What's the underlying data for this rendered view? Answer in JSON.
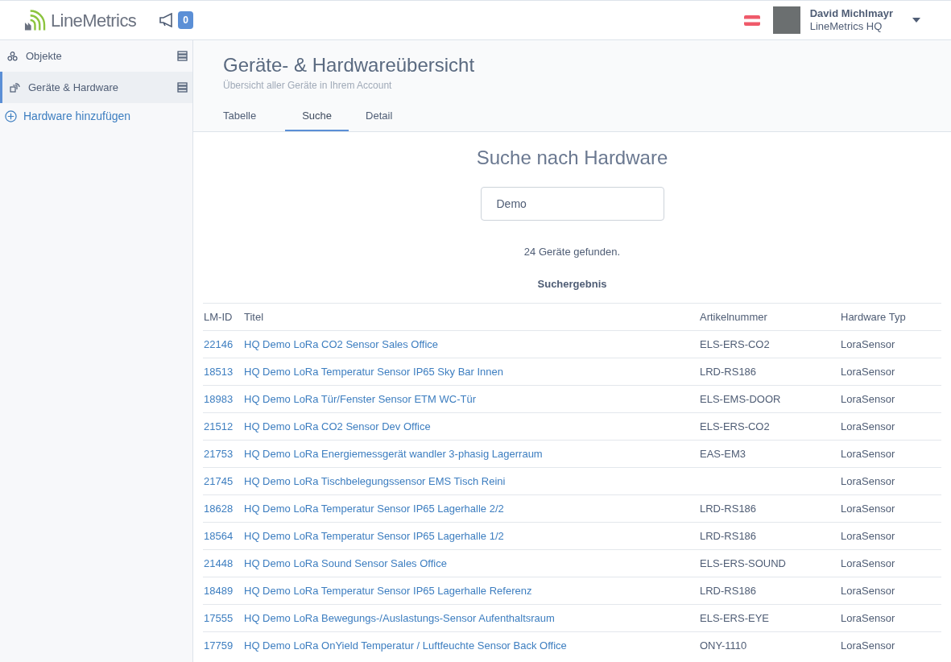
{
  "header": {
    "logo": "LineMetrics",
    "notifications": "0",
    "user": {
      "name": "David Michlmayr",
      "org": "LineMetrics HQ"
    }
  },
  "sidebar": {
    "items": [
      {
        "label": "Objekte",
        "selected": false
      },
      {
        "label": "Geräte & Hardware",
        "selected": true
      }
    ],
    "add_link": "Hardware hinzufügen"
  },
  "page": {
    "title": "Geräte- & Hardwareübersicht",
    "subtitle": "Übersicht aller Geräte in Ihrem Account"
  },
  "tabs": [
    {
      "label": "Tabelle",
      "selected": false
    },
    {
      "label": "Suche",
      "selected": true
    },
    {
      "label": "Detail",
      "selected": false
    }
  ],
  "search": {
    "heading": "Suche nach Hardware",
    "value": "Demo",
    "result_count": "24 Geräte gefunden.",
    "result_heading": "Suchergebnis"
  },
  "table": {
    "columns": [
      "LM-ID",
      "Titel",
      "Artikelnummer",
      "Hardware Typ"
    ],
    "rows": [
      [
        "22146",
        "HQ Demo LoRa CO2 Sensor Sales Office",
        "ELS-ERS-CO2",
        "LoraSensor"
      ],
      [
        "18513",
        "HQ Demo LoRa Temperatur Sensor IP65 Sky Bar Innen",
        "LRD-RS186",
        "LoraSensor"
      ],
      [
        "18983",
        "HQ Demo LoRa Tür/Fenster Sensor ETM WC-Tür",
        "ELS-EMS-DOOR",
        "LoraSensor"
      ],
      [
        "21512",
        "HQ Demo LoRa CO2 Sensor Dev Office",
        "ELS-ERS-CO2",
        "LoraSensor"
      ],
      [
        "21753",
        "HQ Demo LoRa Energiemessgerät wandler 3-phasig Lagerraum",
        "EAS-EM3",
        "LoraSensor"
      ],
      [
        "21745",
        "HQ Demo LoRa Tischbelegungssensor EMS Tisch Reini",
        "",
        "LoraSensor"
      ],
      [
        "18628",
        "HQ Demo LoRa Temperatur Sensor IP65 Lagerhalle 2/2",
        "LRD-RS186",
        "LoraSensor"
      ],
      [
        "18564",
        "HQ Demo LoRa Temperatur Sensor IP65 Lagerhalle 1/2",
        "LRD-RS186",
        "LoraSensor"
      ],
      [
        "21448",
        "HQ Demo LoRa Sound Sensor Sales Office",
        "ELS-ERS-SOUND",
        "LoraSensor"
      ],
      [
        "18489",
        "HQ Demo LoRa Temperatur Sensor IP65 Lagerhalle Referenz",
        "LRD-RS186",
        "LoraSensor"
      ],
      [
        "17555",
        "HQ Demo LoRa Bewegungs-/Auslastungs-Sensor Aufenthaltsraum",
        "ELS-ERS-EYE",
        "LoraSensor"
      ],
      [
        "17759",
        "HQ Demo LoRa OnYield Temperatur / Luftfeuchte Sensor Back Office",
        "ONY-1110",
        "LoraSensor"
      ]
    ]
  }
}
